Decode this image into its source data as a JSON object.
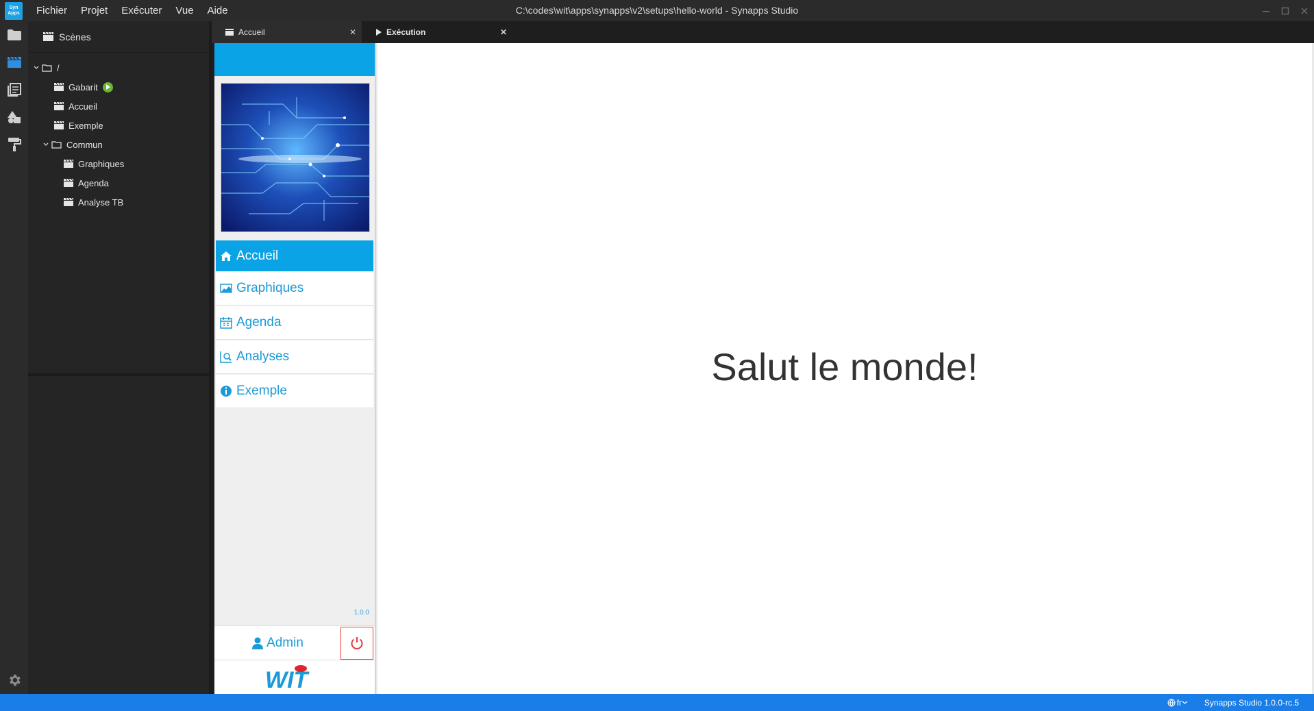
{
  "app": {
    "logo_text": "Syn Apps",
    "window_title": "C:\\codes\\wit\\apps\\synapps\\v2\\setups\\hello-world - Synapps Studio",
    "menu": [
      "Fichier",
      "Projet",
      "Exécuter",
      "Vue",
      "Aide"
    ]
  },
  "activity_bar": {
    "items": [
      "folder-icon",
      "clapperboard-icon",
      "pages-icon",
      "shapes-icon",
      "paint-roller-icon"
    ],
    "bottom": "gear-icon"
  },
  "sidebar": {
    "title": "Scènes",
    "tree": {
      "root": "/",
      "items": [
        "Gabarit",
        "Accueil",
        "Exemple"
      ],
      "folder": "Commun",
      "folder_items": [
        "Graphiques",
        "Agenda",
        "Analyse TB"
      ]
    }
  },
  "tabs": [
    {
      "label": "Accueil",
      "icon": "clapperboard-icon"
    },
    {
      "label": "Exécution",
      "icon": "play-icon"
    }
  ],
  "preview": {
    "nav": [
      {
        "label": "Accueil",
        "icon": "home-icon"
      },
      {
        "label": "Graphiques",
        "icon": "chart-icon"
      },
      {
        "label": "Agenda",
        "icon": "calendar-icon"
      },
      {
        "label": "Analyses",
        "icon": "analysis-icon"
      },
      {
        "label": "Exemple",
        "icon": "info-icon"
      }
    ],
    "version": "1.0.0",
    "user": "Admin",
    "brand": "WIT",
    "content_text": "Salut le monde!"
  },
  "status": {
    "language": "fr",
    "version": "Synapps Studio 1.0.0-rc.5"
  },
  "colors": {
    "accent": "#0aa3e6",
    "status_bar": "#1a7ee8",
    "play_badge": "#6ab633",
    "power": "#e23b3b"
  }
}
